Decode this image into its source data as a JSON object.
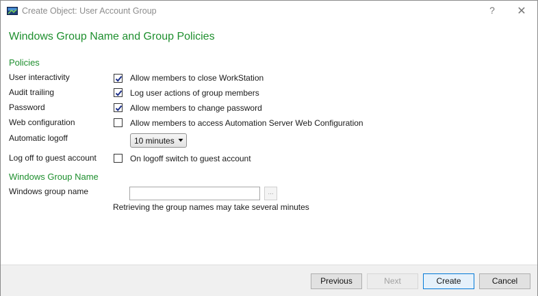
{
  "window": {
    "title": "Create Object: User Account Group",
    "help_glyph": "?",
    "close_glyph": "✕"
  },
  "heading": "Windows Group Name and Group Policies",
  "policies": {
    "section_title": "Policies",
    "rows": [
      {
        "label": "User interactivity",
        "option": "Allow members to close WorkStation",
        "checked": true
      },
      {
        "label": "Audit trailing",
        "option": "Log user actions of group members",
        "checked": true
      },
      {
        "label": "Password",
        "option": "Allow members to change password",
        "checked": true
      },
      {
        "label": "Web configuration",
        "option": "Allow members to access Automation Server Web Configuration",
        "checked": false
      }
    ],
    "automatic_logoff": {
      "label": "Automatic logoff",
      "selected": "10 minutes"
    },
    "guest": {
      "label": "Log off to guest account",
      "option": "On logoff switch to guest account",
      "checked": false
    }
  },
  "windows_group": {
    "section_title": "Windows Group Name",
    "field_label": "Windows group name",
    "value": "",
    "browse_label": "...",
    "hint": "Retrieving the group names may take several minutes"
  },
  "footer": {
    "previous": "Previous",
    "next": "Next",
    "create": "Create",
    "cancel": "Cancel"
  },
  "colors": {
    "accent_green": "#1e8f2e",
    "primary_border": "#0078d7"
  }
}
